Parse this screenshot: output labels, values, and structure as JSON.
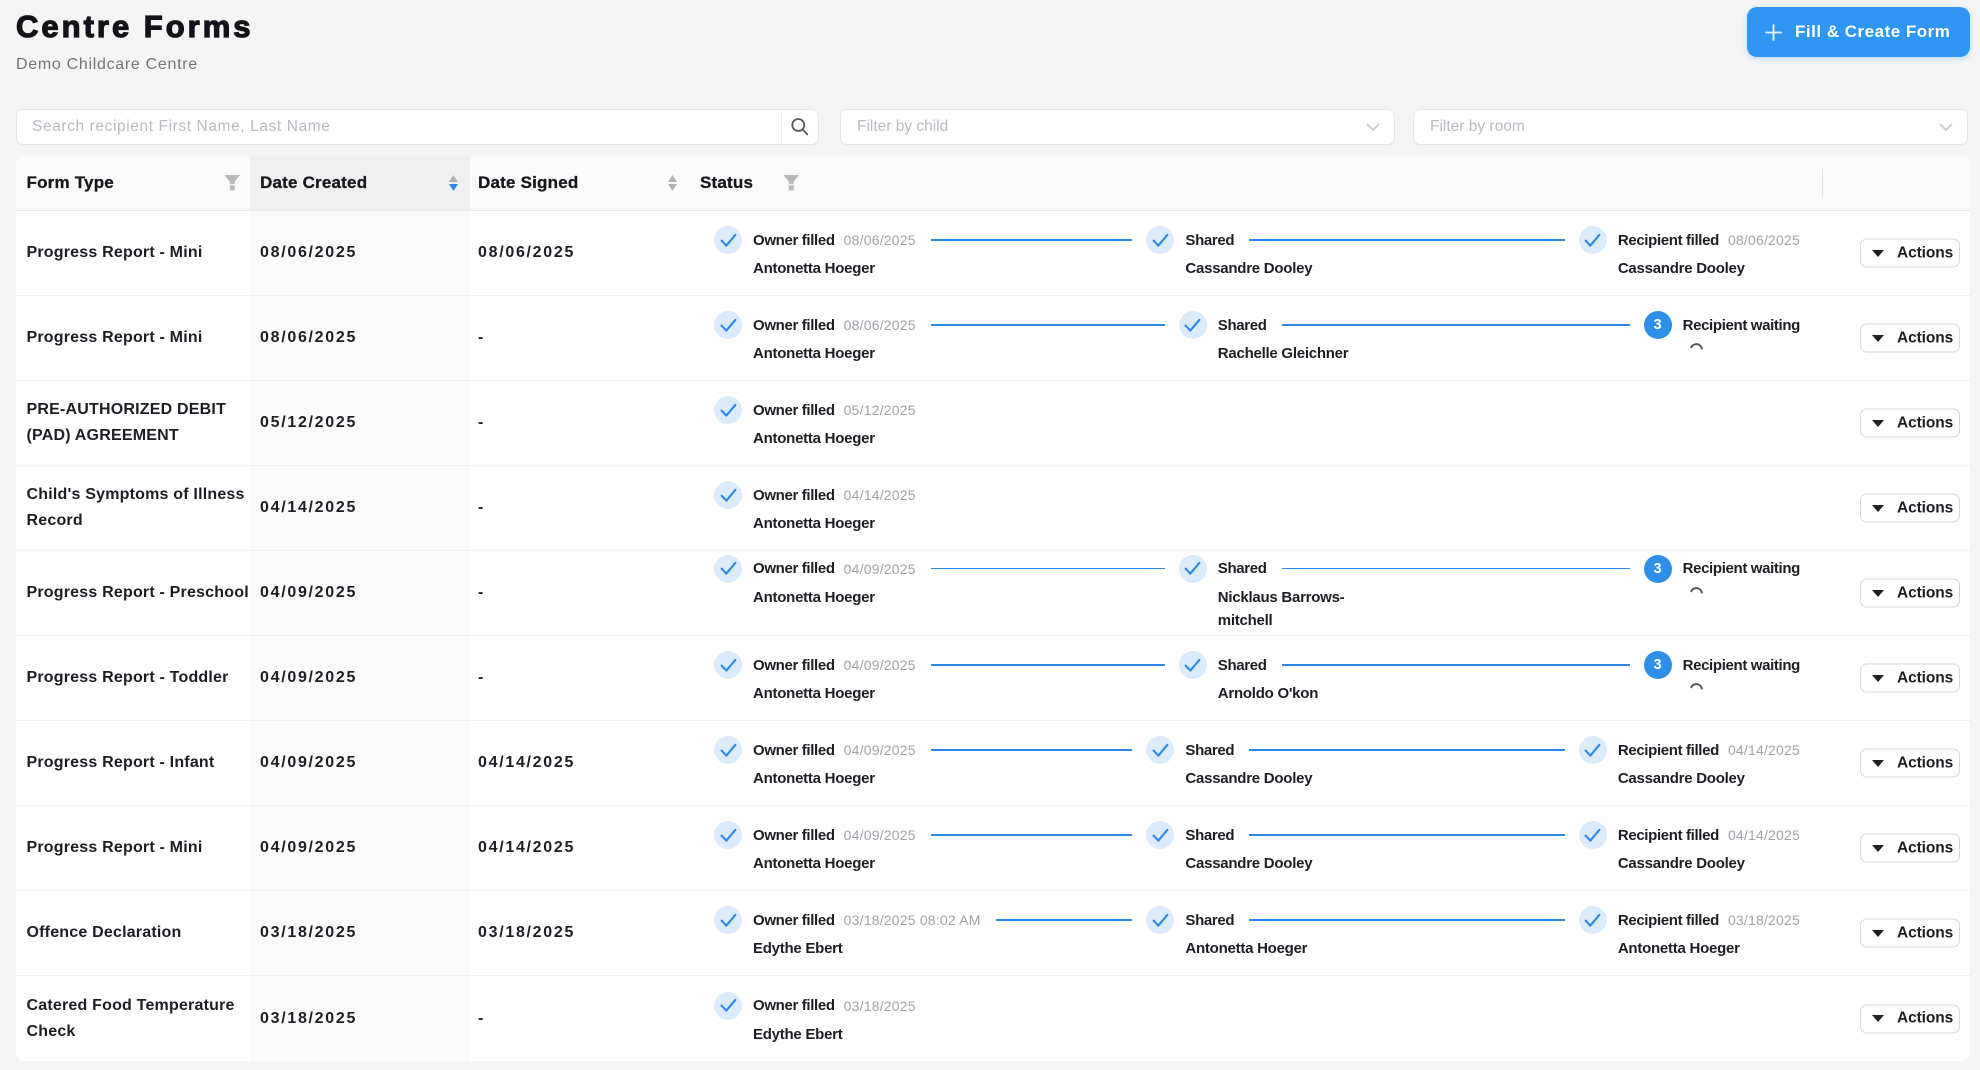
{
  "header": {
    "title": "Centre Forms",
    "subtitle": "Demo Childcare Centre",
    "create_button": "Fill & Create Form",
    "plus_icon": "+"
  },
  "filters": {
    "search_placeholder": "Search recipient First Name, Last Name",
    "search_value": "",
    "child_placeholder": "Filter by child",
    "room_placeholder": "Filter by room"
  },
  "colors": {
    "accent_blue": "#2f96f3",
    "timeline_blue": "#2b87e9",
    "check_circle_bg": "#dcebfb",
    "badge_blue": "#2e8fe9"
  },
  "table": {
    "columns": [
      {
        "key": "form_type",
        "label": "Form Type",
        "icon": "filter"
      },
      {
        "key": "date_created",
        "label": "Date Created",
        "icon": "sort",
        "sort_active": "desc"
      },
      {
        "key": "date_signed",
        "label": "Date Signed",
        "icon": "sort"
      },
      {
        "key": "status",
        "label": "Status",
        "icon": "filter"
      }
    ],
    "actions_label": "Actions",
    "rows": [
      {
        "form_type": "Progress Report - Mini",
        "date_created": "08/06/2025",
        "date_signed": "08/06/2025",
        "steps": [
          {
            "type": "check",
            "label": "Owner filled",
            "date": "08/06/2025",
            "name": "Antonetta Hoeger"
          },
          {
            "type": "check",
            "label": "Shared",
            "name": "Cassandre Dooley"
          },
          {
            "type": "check",
            "label": "Recipient filled",
            "date": "08/06/2025",
            "name": "Cassandre Dooley"
          }
        ]
      },
      {
        "form_type": "Progress Report - Mini",
        "date_created": "08/06/2025",
        "date_signed": "-",
        "steps": [
          {
            "type": "check",
            "label": "Owner filled",
            "date": "08/06/2025",
            "name": "Antonetta Hoeger"
          },
          {
            "type": "check",
            "label": "Shared",
            "name": "Rachelle Gleichner"
          },
          {
            "type": "waiting",
            "label": "Recipient waiting",
            "badge": "3"
          }
        ]
      },
      {
        "form_type": "PRE-AUTHORIZED DEBIT (PAD) AGREEMENT",
        "date_created": "05/12/2025",
        "date_signed": "-",
        "steps": [
          {
            "type": "check",
            "label": "Owner filled",
            "date": "05/12/2025",
            "name": "Antonetta Hoeger"
          }
        ]
      },
      {
        "form_type": "Child's Symptoms of Illness Record",
        "date_created": "04/14/2025",
        "date_signed": "-",
        "steps": [
          {
            "type": "check",
            "label": "Owner filled",
            "date": "04/14/2025",
            "name": "Antonetta Hoeger"
          }
        ]
      },
      {
        "form_type": "Progress Report - Preschool",
        "date_created": "04/09/2025",
        "date_signed": "-",
        "steps": [
          {
            "type": "check",
            "label": "Owner filled",
            "date": "04/09/2025",
            "name": "Antonetta Hoeger"
          },
          {
            "type": "check",
            "label": "Shared",
            "name": "Nicklaus Barrows-\nmitchell"
          },
          {
            "type": "waiting",
            "label": "Recipient waiting",
            "badge": "3"
          }
        ]
      },
      {
        "form_type": "Progress Report - Toddler",
        "date_created": "04/09/2025",
        "date_signed": "-",
        "steps": [
          {
            "type": "check",
            "label": "Owner filled",
            "date": "04/09/2025",
            "name": "Antonetta Hoeger"
          },
          {
            "type": "check",
            "label": "Shared",
            "name": "Arnoldo O'kon"
          },
          {
            "type": "waiting",
            "label": "Recipient waiting",
            "badge": "3"
          }
        ]
      },
      {
        "form_type": "Progress Report - Infant",
        "date_created": "04/09/2025",
        "date_signed": "04/14/2025",
        "steps": [
          {
            "type": "check",
            "label": "Owner filled",
            "date": "04/09/2025",
            "name": "Antonetta Hoeger"
          },
          {
            "type": "check",
            "label": "Shared",
            "name": "Cassandre Dooley"
          },
          {
            "type": "check",
            "label": "Recipient filled",
            "date": "04/14/2025",
            "name": "Cassandre Dooley"
          }
        ]
      },
      {
        "form_type": "Progress Report - Mini",
        "date_created": "04/09/2025",
        "date_signed": "04/14/2025",
        "steps": [
          {
            "type": "check",
            "label": "Owner filled",
            "date": "04/09/2025",
            "name": "Antonetta Hoeger"
          },
          {
            "type": "check",
            "label": "Shared",
            "name": "Cassandre Dooley"
          },
          {
            "type": "check",
            "label": "Recipient filled",
            "date": "04/14/2025",
            "name": "Cassandre Dooley"
          }
        ]
      },
      {
        "form_type": "Offence Declaration",
        "date_created": "03/18/2025",
        "date_signed": "03/18/2025",
        "steps": [
          {
            "type": "check",
            "label": "Owner filled",
            "date": "03/18/2025 08:02 AM",
            "name": "Edythe Ebert"
          },
          {
            "type": "check",
            "label": "Shared",
            "name": "Antonetta Hoeger"
          },
          {
            "type": "check",
            "label": "Recipient filled",
            "date": "03/18/2025",
            "name": "Antonetta Hoeger"
          }
        ]
      },
      {
        "form_type": "Catered Food Temperature Check",
        "date_created": "03/18/2025",
        "date_signed": "-",
        "steps": [
          {
            "type": "check",
            "label": "Owner filled",
            "date": "03/18/2025",
            "name": "Edythe Ebert"
          }
        ]
      }
    ]
  }
}
